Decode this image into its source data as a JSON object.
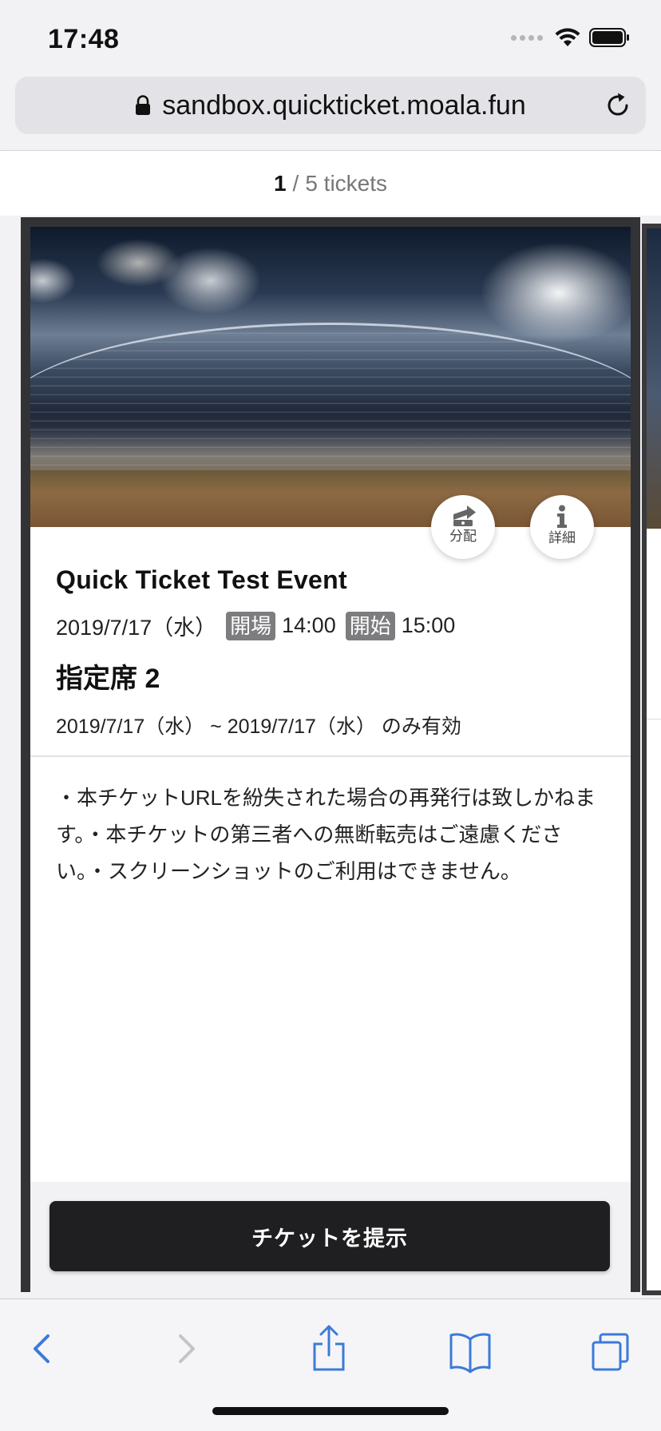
{
  "status_bar": {
    "time": "17:48",
    "icons": [
      "signal-icon",
      "wifi-icon",
      "battery-icon"
    ]
  },
  "browser": {
    "url": "sandbox.quickticket.moala.fun",
    "lock_icon": "lock-icon",
    "reload_icon": "reload-icon"
  },
  "ticket_counter": {
    "current": "1",
    "separator": "/",
    "total_label": "5 tickets"
  },
  "ticket": {
    "hero_image": "stadium-photo",
    "distribute_button": {
      "icon": "share-ticket-icon",
      "label": "分配"
    },
    "detail_button": {
      "icon": "info-icon",
      "label": "詳細"
    },
    "event_title": "Quick Ticket Test Event",
    "date": "2019/7/17（水）",
    "open_tag": "開場",
    "open_time": "14:00",
    "start_tag": "開始",
    "start_time": "15:00",
    "seat_name": "指定席 2",
    "valid_period": "2019/7/17（水） ~ 2019/7/17（水） のみ有効",
    "notes": "・本チケットURLを紛失された場合の再発行は致しかねます。・本チケットの第三者への無断転売はご遠慮ください。・スクリーンショットのご利用はできません。",
    "present_button": "チケットを提示"
  },
  "toolbar": {
    "back": "back-chevron-icon",
    "forward": "forward-chevron-icon",
    "share": "share-icon",
    "bookmarks": "bookmarks-icon",
    "tabs": "tabs-icon"
  },
  "colors": {
    "ios_blue": "#3b7ad9",
    "button_dark": "#1f1f21",
    "tag_gray": "#7d7d80",
    "card_border": "#333335"
  }
}
